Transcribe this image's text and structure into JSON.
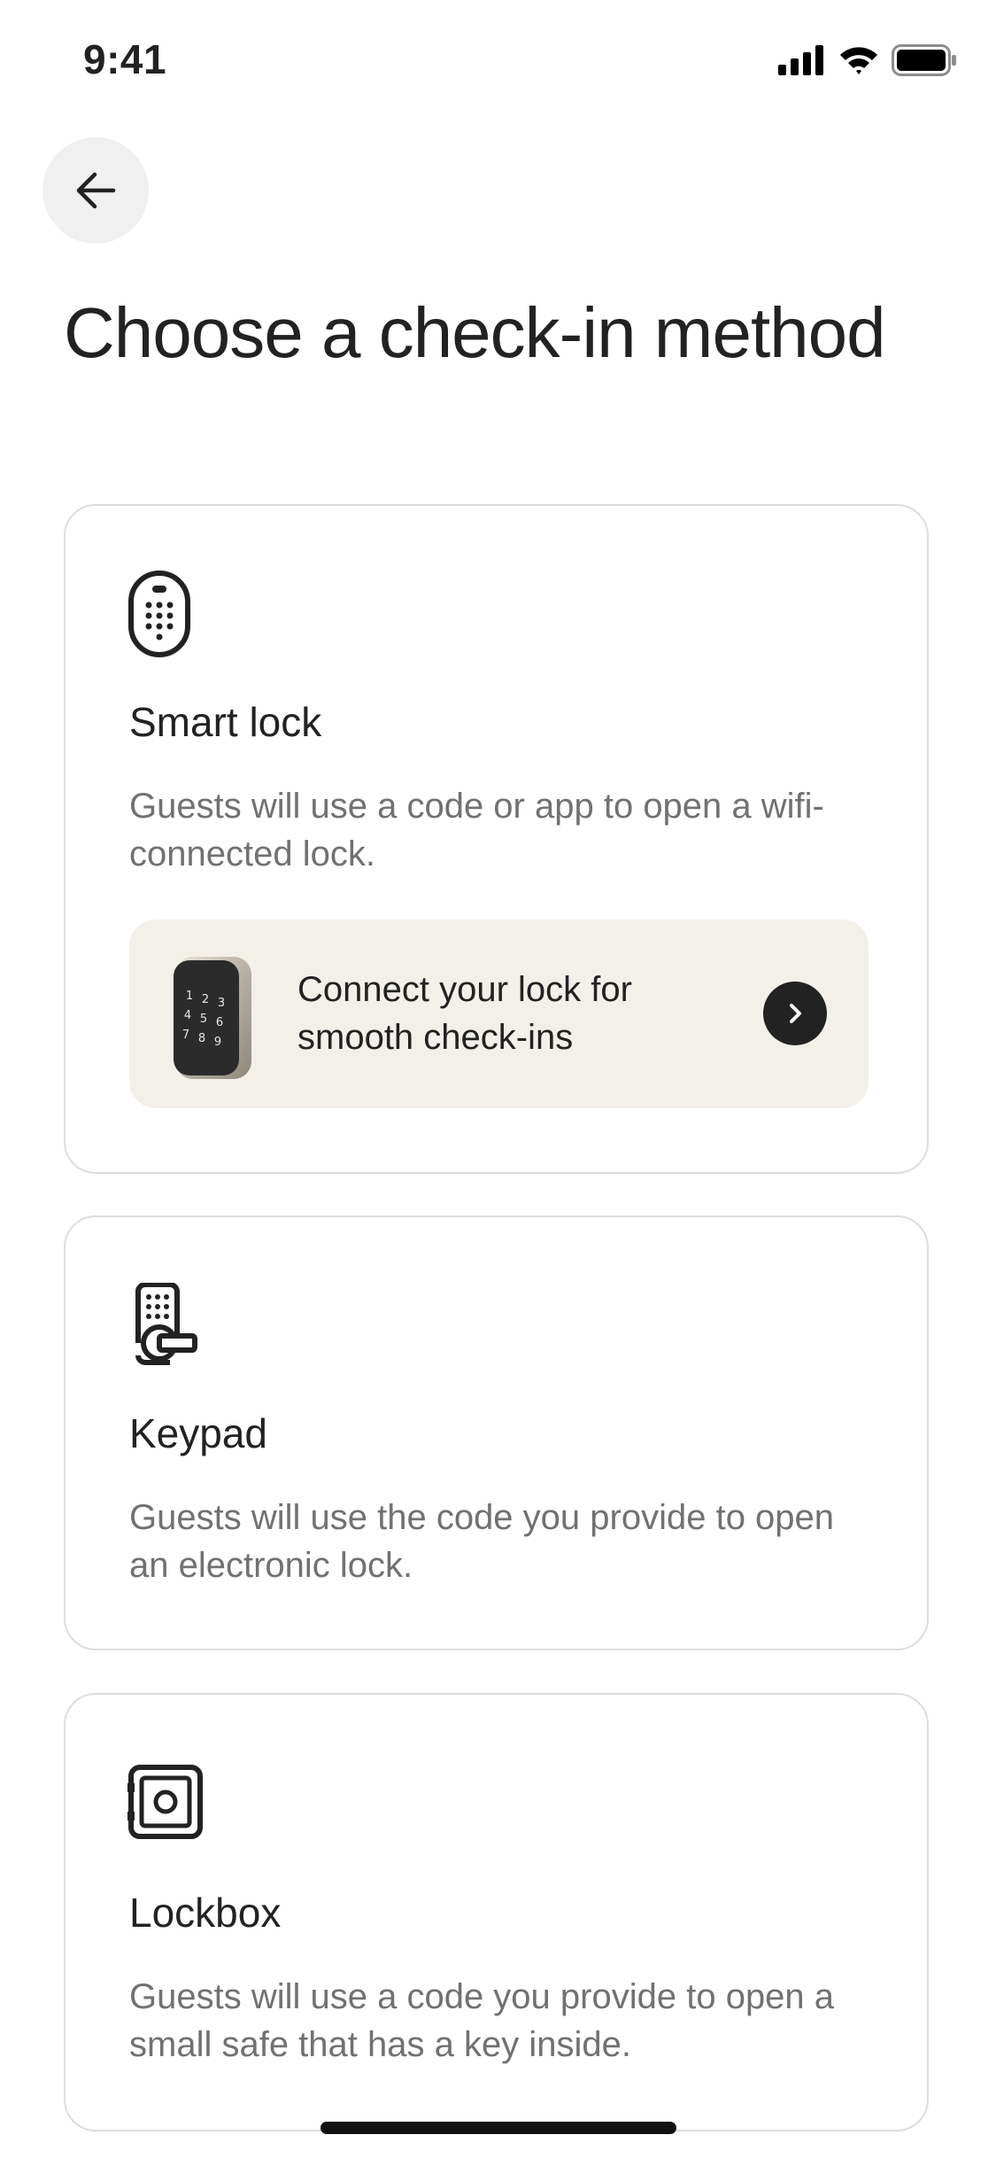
{
  "status_bar": {
    "time": "9:41"
  },
  "header": {
    "title": "Choose a check-in method"
  },
  "options": [
    {
      "icon": "smart-lock-icon",
      "title": "Smart lock",
      "description": "Guests will use a code or app to open a wifi-connected lock.",
      "promo": {
        "text": "Connect your lock for smooth check-ins",
        "keypad_digits": [
          "1",
          "2",
          "3",
          "4",
          "5",
          "6",
          "7",
          "8",
          "9"
        ]
      }
    },
    {
      "icon": "keypad-icon",
      "title": "Keypad",
      "description": "Guests will use the code you provide to open an electronic lock."
    },
    {
      "icon": "lockbox-icon",
      "title": "Lockbox",
      "description": "Guests will use a code you provide to open a small safe that has a key inside."
    }
  ],
  "colors": {
    "text_primary": "#222222",
    "text_secondary": "#717171",
    "card_border": "#dddddd",
    "promo_background": "#f3f0ea",
    "back_button_background": "#f0f0f0"
  }
}
